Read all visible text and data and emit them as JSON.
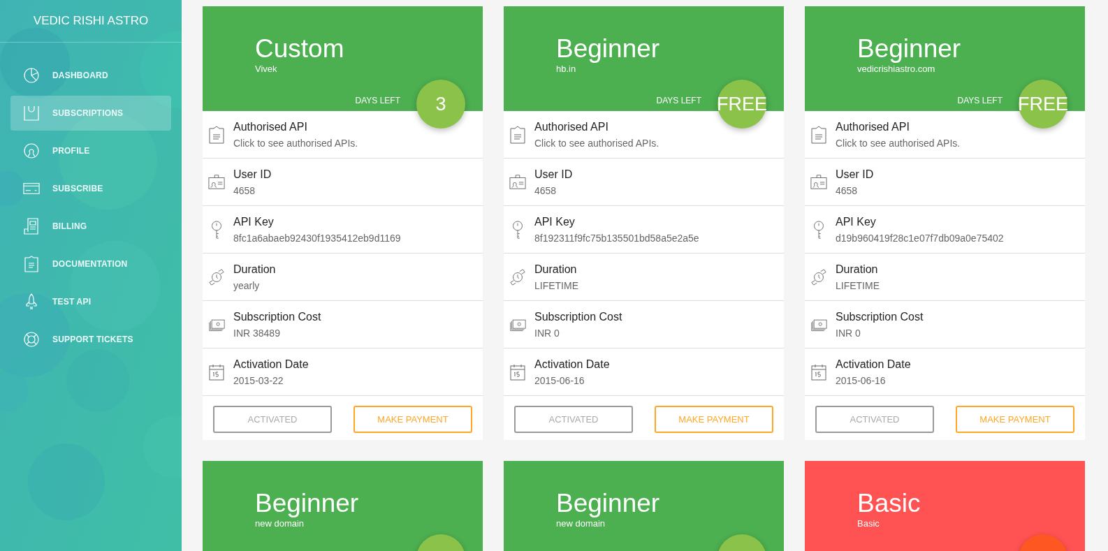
{
  "sidebar": {
    "brand": "VEDIC RISHI ASTRO",
    "items": [
      {
        "kind": "chart",
        "label": "DASHBOARD",
        "selected": false
      },
      {
        "kind": "bag",
        "label": "SUBSCRIPTIONS",
        "selected": true
      },
      {
        "kind": "person",
        "label": "PROFILE",
        "selected": false
      },
      {
        "kind": "card",
        "label": "SUBSCRIBE",
        "selected": false
      },
      {
        "kind": "billing",
        "label": "BILLING",
        "selected": false
      },
      {
        "kind": "doc",
        "label": "DOCUMENTATION",
        "selected": false
      },
      {
        "kind": "rocket",
        "label": "TEST API",
        "selected": false
      },
      {
        "kind": "lifebuoy",
        "label": "SUPPORT TICKETS",
        "selected": false
      }
    ]
  },
  "plans": [
    {
      "title": "Custom",
      "subtitle": "Vivek",
      "color": "#4caf50",
      "days_left_label": "DAYS LEFT",
      "badge": {
        "text": "3",
        "color": "#8bc34a"
      },
      "rows": [
        {
          "kind": "api",
          "label": "Authorised API",
          "value": "Click to see authorised APIs."
        },
        {
          "kind": "user",
          "label": "User ID",
          "value": "4658"
        },
        {
          "kind": "key",
          "label": "API Key",
          "value": "8fc1a6abaeb92430f1935412eb9d1169"
        },
        {
          "kind": "duration",
          "label": "Duration",
          "value": "yearly"
        },
        {
          "kind": "cost",
          "label": "Subscription Cost",
          "value": "INR 38489"
        },
        {
          "kind": "date",
          "label": "Activation Date",
          "value": "2015-03-22"
        }
      ],
      "buttons": [
        {
          "kind": "activated",
          "label": "ACTIVATED"
        },
        {
          "kind": "pay",
          "label": "MAKE PAYMENT"
        }
      ]
    },
    {
      "title": "Beginner",
      "subtitle": "hb.in",
      "color": "#4caf50",
      "days_left_label": "DAYS LEFT",
      "badge": {
        "text": "FREE",
        "color": "#8bc34a"
      },
      "rows": [
        {
          "kind": "api",
          "label": "Authorised API",
          "value": "Click to see authorised APIs."
        },
        {
          "kind": "user",
          "label": "User ID",
          "value": "4658"
        },
        {
          "kind": "key",
          "label": "API Key",
          "value": "8f192311f9fc75b135501bd58a5e2a5e"
        },
        {
          "kind": "duration",
          "label": "Duration",
          "value": "LIFETIME"
        },
        {
          "kind": "cost",
          "label": "Subscription Cost",
          "value": "INR 0"
        },
        {
          "kind": "date",
          "label": "Activation Date",
          "value": "2015-06-16"
        }
      ],
      "buttons": [
        {
          "kind": "activated",
          "label": "ACTIVATED"
        },
        {
          "kind": "pay",
          "label": "MAKE PAYMENT"
        }
      ]
    },
    {
      "title": "Beginner",
      "subtitle": "vedicrishiastro.com",
      "color": "#4caf50",
      "days_left_label": "DAYS LEFT",
      "badge": {
        "text": "FREE",
        "color": "#8bc34a"
      },
      "rows": [
        {
          "kind": "api",
          "label": "Authorised API",
          "value": "Click to see authorised APIs."
        },
        {
          "kind": "user",
          "label": "User ID",
          "value": "4658"
        },
        {
          "kind": "key",
          "label": "API Key",
          "value": "d19b960419f28c1e07f7db09a0e75402"
        },
        {
          "kind": "duration",
          "label": "Duration",
          "value": "LIFETIME"
        },
        {
          "kind": "cost",
          "label": "Subscription Cost",
          "value": "INR 0"
        },
        {
          "kind": "date",
          "label": "Activation Date",
          "value": "2015-06-16"
        }
      ],
      "buttons": [
        {
          "kind": "activated",
          "label": "ACTIVATED"
        },
        {
          "kind": "pay",
          "label": "MAKE PAYMENT"
        }
      ]
    },
    {
      "title": "Beginner",
      "subtitle": "new domain",
      "color": "#4caf50",
      "badge": {
        "color": "#8bc34a"
      }
    },
    {
      "title": "Beginner",
      "subtitle": "new domain",
      "color": "#4caf50",
      "badge": {
        "color": "#8bc34a"
      }
    },
    {
      "title": "Basic",
      "subtitle": "Basic",
      "color": "#ff5252",
      "badge": {
        "color": "#ff5722"
      }
    }
  ]
}
